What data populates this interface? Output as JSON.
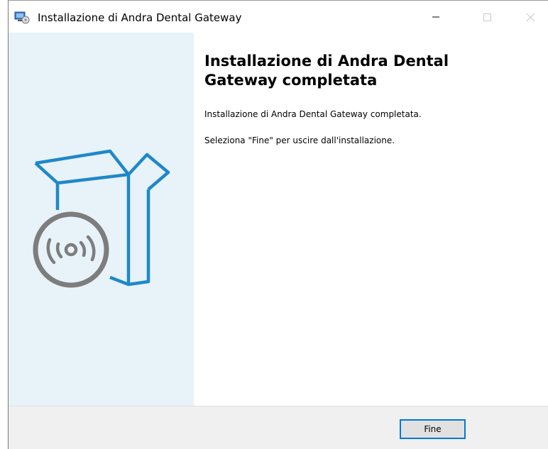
{
  "window": {
    "title": "Installazione di Andra Dental Gateway",
    "app_icon": "installer-monitor-cd-icon",
    "controls": [
      "minimize-icon",
      "maximize-icon",
      "close-icon"
    ]
  },
  "sidebar": {
    "graphic": "box-with-cd-icon",
    "background": "#e8f2f9",
    "accent": "#1e88c9"
  },
  "content": {
    "heading": "Installazione di Andra Dental Gateway completata",
    "message": "Installazione di Andra Dental Gateway completata.",
    "instruction": "Seleziona \"Fine\" per uscire dall'installazione."
  },
  "footer": {
    "finish_label": "Fine"
  }
}
